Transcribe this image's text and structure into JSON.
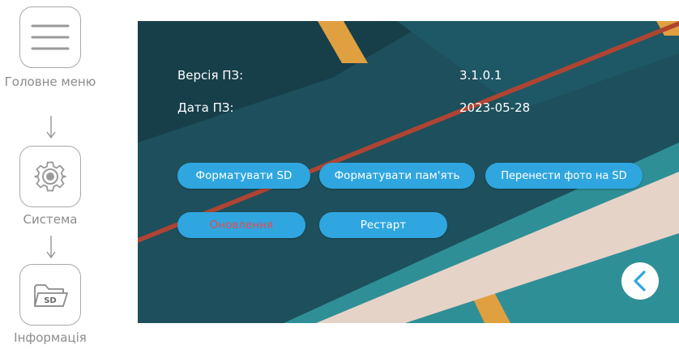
{
  "guide": {
    "steps": [
      {
        "label": "Головне меню",
        "icon": "menu-icon"
      },
      {
        "label": "Система",
        "icon": "gear-icon"
      },
      {
        "label": "Інформація",
        "icon": "sd-folder-icon",
        "icon_text": "SD"
      }
    ]
  },
  "screen": {
    "info": [
      {
        "label": "Версія ПЗ:",
        "value": "3.1.0.1"
      },
      {
        "label": "Дата ПЗ:",
        "value": "2023-05-28"
      }
    ],
    "buttons": {
      "format_sd": "Форматувати SD",
      "format_memory": "Форматувати пам'ять",
      "move_photos": "Перенести фото на SD",
      "update": "Оновлення",
      "restart": "Рестарт"
    },
    "back_icon": "chevron-left-icon"
  },
  "colors": {
    "button": "#2fa6e0",
    "button_text": "#ffffff",
    "warning_text": "#e14d4d",
    "guide_gray": "#8c8c8c"
  }
}
